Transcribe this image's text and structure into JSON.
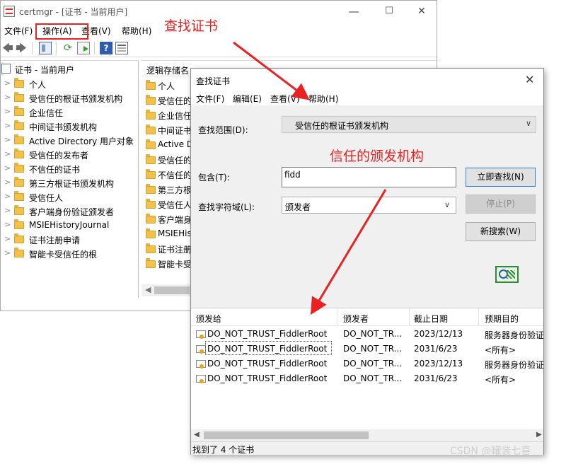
{
  "certmgr": {
    "title": "certmgr - [证书 - 当前用户]",
    "window_controls": {
      "minimize": "—",
      "maximize": "☐",
      "close": "✕"
    },
    "menu": {
      "file": "文件(F)",
      "action": "操作(A)",
      "view": "查看(V)",
      "help": "帮助(H)"
    },
    "toolbar": {
      "icons": [
        "back-arrow-icon",
        "forward-arrow-icon",
        "up-level-icon",
        "refresh-icon",
        "export-list-icon",
        "help-icon",
        "properties-icon"
      ],
      "back_glyph": "🡄",
      "forward_glyph": "🡆",
      "refresh_glyph": "⟳",
      "help_glyph": "?"
    },
    "tree": {
      "root": "证书 - 当前用户",
      "items": [
        "个人",
        "受信任的根证书颁发机构",
        "企业信任",
        "中间证书颁发机构",
        "Active Directory 用户对象",
        "受信任的发布者",
        "不信任的证书",
        "第三方根证书颁发机构",
        "受信任人",
        "客户端身份验证颁发者",
        "MSIEHistoryJournal",
        "证书注册申请",
        "智能卡受信任的根"
      ]
    },
    "list": {
      "header": "逻辑存储名",
      "items": [
        "个人",
        "受信任的",
        "企业信任",
        "中间证书",
        "Active D",
        "受信任的",
        "不信任的",
        "第三方根",
        "受信任人",
        "客户端身",
        "MSIEHis",
        "证书注册",
        "智能卡受"
      ]
    },
    "scroll_left_glyph": "◀"
  },
  "find_dialog": {
    "title": "查找证书",
    "close_glyph": "✕",
    "menu": {
      "file": "文件(F)",
      "edit": "编辑(E)",
      "view": "查看(V)",
      "help": "帮助(H)"
    },
    "scope_label": "查找范围(D):",
    "scope_value": "受信任的根证书颁发机构",
    "contains_label": "包含(T):",
    "contains_value": "fidd",
    "field_label": "查找字符域(L):",
    "field_value": "颁发者",
    "buttons": {
      "find_now": "立即查找(N)",
      "stop": "停止(P)",
      "new_search": "新搜索(W)"
    },
    "columns": [
      "颁发给",
      "颁发者",
      "截止日期",
      "预期目的"
    ],
    "results": [
      {
        "issued_to": "DO_NOT_TRUST_FiddlerRoot",
        "issuer": "DO_NOT_TR...",
        "expires": "2023/12/13",
        "purpose": "服务器身份验证"
      },
      {
        "issued_to": "DO_NOT_TRUST_FiddlerRoot",
        "issuer": "DO_NOT_TR...",
        "expires": "2031/6/23",
        "purpose": "<所有>"
      },
      {
        "issued_to": "DO_NOT_TRUST_FiddlerRoot",
        "issuer": "DO_NOT_TR...",
        "expires": "2023/12/13",
        "purpose": "服务器身份验证"
      },
      {
        "issued_to": "DO_NOT_TRUST_FiddlerRoot",
        "issuer": "DO_NOT_TR...",
        "expires": "2031/6/23",
        "purpose": "<所有>"
      }
    ],
    "status": "找到了 4 个证书",
    "scroll_left_glyph": "◀",
    "scroll_right_glyph": "▶",
    "dropdown_glyph": "∨"
  },
  "annotations": {
    "find_cert": "查找证书",
    "trusted_ca": "信任的颁发机构",
    "color": "#e82222"
  },
  "watermark": "CSDN @罐装七喜"
}
